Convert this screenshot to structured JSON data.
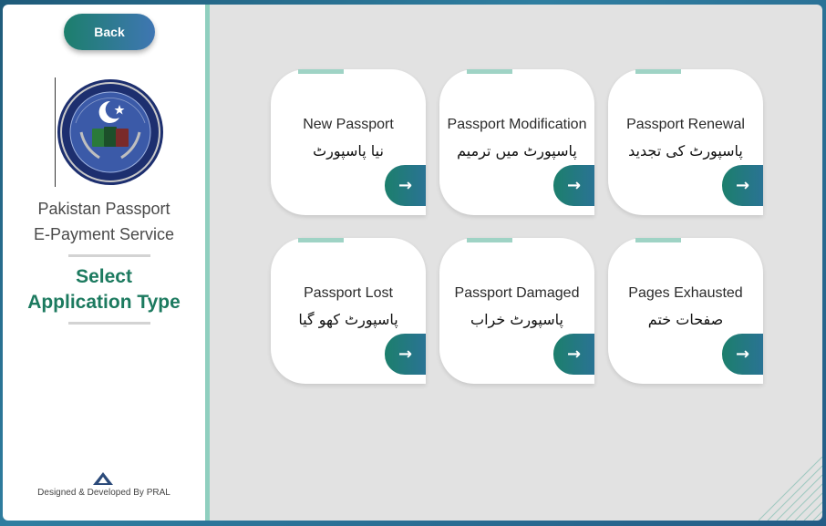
{
  "sidebar": {
    "back_label": "Back",
    "brand_line1": "Pakistan Passport",
    "brand_line2": "E-Payment Service",
    "select_line1": "Select",
    "select_line2": "Application Type",
    "footer": "Designed & Developed By PRAL"
  },
  "cards": [
    {
      "title": "New Passport",
      "urdu": "نیا پاسپورٹ"
    },
    {
      "title": "Passport Modification",
      "urdu": "پاسپورٹ میں ترمیم"
    },
    {
      "title": "Passport Renewal",
      "urdu": "پاسپورٹ کی تجدید"
    },
    {
      "title": "Passport Lost",
      "urdu": "پاسپورٹ کھو گیا"
    },
    {
      "title": "Passport Damaged",
      "urdu": "پاسپورٹ خراب"
    },
    {
      "title": "Pages Exhausted",
      "urdu": "صفحات ختم"
    }
  ],
  "icons": {
    "arrow": "arrow-right-icon",
    "logo": "dgip-logo",
    "footer_logo": "pral-logo-icon"
  },
  "colors": {
    "accent_green": "#1c7a5f",
    "divider": "#8fcfbf",
    "main_bg": "#e2e2e2"
  }
}
